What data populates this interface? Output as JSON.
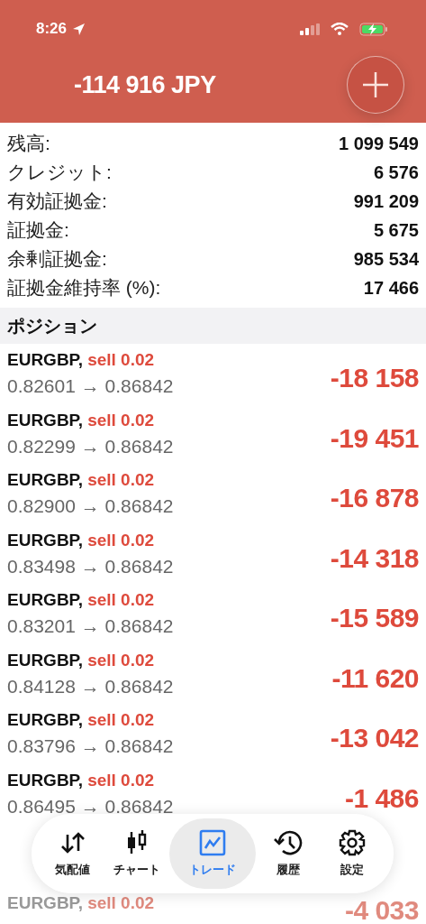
{
  "status_bar": {
    "time": "8:26"
  },
  "header": {
    "balance": "-114 916 JPY"
  },
  "summary": [
    {
      "label": "残高:",
      "value": "1 099 549"
    },
    {
      "label": "クレジット:",
      "value": "6 576"
    },
    {
      "label": "有効証拠金:",
      "value": "991 209"
    },
    {
      "label": "証拠金:",
      "value": "5 675"
    },
    {
      "label": "余剰証拠金:",
      "value": "985 534"
    },
    {
      "label": "証拠金維持率 (%):",
      "value": "17 466"
    }
  ],
  "section_title": "ポジション",
  "positions": [
    {
      "symbol": "EURGBP,",
      "side": "sell 0.02",
      "prices": "0.82601 → 0.86842",
      "profit": "-18 158"
    },
    {
      "symbol": "EURGBP,",
      "side": "sell 0.02",
      "prices": "0.82299 → 0.86842",
      "profit": "-19 451"
    },
    {
      "symbol": "EURGBP,",
      "side": "sell 0.02",
      "prices": "0.82900 → 0.86842",
      "profit": "-16 878"
    },
    {
      "symbol": "EURGBP,",
      "side": "sell 0.02",
      "prices": "0.83498 → 0.86842",
      "profit": "-14 318"
    },
    {
      "symbol": "EURGBP,",
      "side": "sell 0.02",
      "prices": "0.83201 → 0.86842",
      "profit": "-15 589"
    },
    {
      "symbol": "EURGBP,",
      "side": "sell 0.02",
      "prices": "0.84128 → 0.86842",
      "profit": "-11 620"
    },
    {
      "symbol": "EURGBP,",
      "side": "sell 0.02",
      "prices": "0.83796 → 0.86842",
      "profit": "-13 042"
    },
    {
      "symbol": "EURGBP,",
      "side": "sell 0.02",
      "prices": "0.86495 → 0.86842",
      "profit": "-1 486"
    }
  ],
  "partial_position": {
    "symbol": "EURGBP,",
    "side": "sell 0.02",
    "profit": "-4 033"
  },
  "tabs": [
    {
      "kind": "quotes",
      "label": "気配値",
      "selected": false
    },
    {
      "kind": "chart",
      "label": "チャート",
      "selected": false
    },
    {
      "kind": "trade",
      "label": "トレード",
      "selected": true
    },
    {
      "kind": "history",
      "label": "履歴",
      "selected": false
    },
    {
      "kind": "settings",
      "label": "設定",
      "selected": false
    }
  ]
}
